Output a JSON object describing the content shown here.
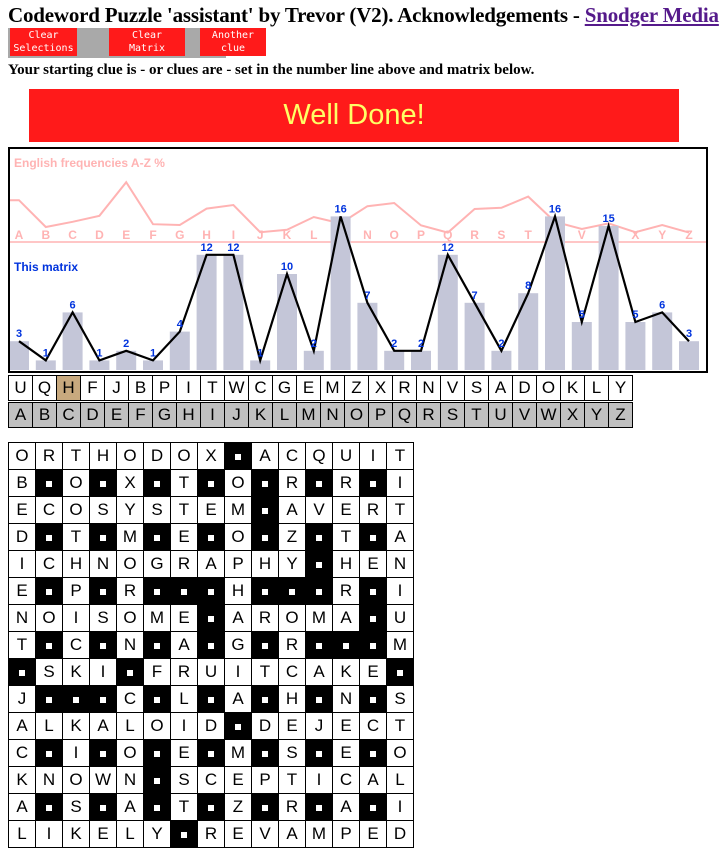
{
  "header": {
    "title": "Codeword Puzzle 'assistant' by Trevor (V2). Acknowledgements - ",
    "link": "Snodger Media"
  },
  "buttons": [
    {
      "line1": "Clear",
      "line2": "Selections"
    },
    {
      "line1": "Clear",
      "line2": "Matrix"
    },
    {
      "line1": "Another",
      "line2": "clue"
    }
  ],
  "instruction": "Your starting clue is - or clues are - set in the number line above and matrix below.",
  "banner": "Well Done!",
  "colors": {
    "accent_red": "#ff1a1a",
    "banner_text": "#ffff66",
    "english_line": "#ffb3b3",
    "matrix_label": "#0033dd",
    "bar_fill": "#c4c6d8",
    "highlight": "#c8a97e"
  },
  "chart_data": [
    {
      "type": "line",
      "title": "English frequencies A-Z %",
      "categories": [
        "A",
        "B",
        "C",
        "D",
        "E",
        "F",
        "G",
        "H",
        "I",
        "J",
        "K",
        "L",
        "M",
        "N",
        "O",
        "P",
        "Q",
        "R",
        "S",
        "T",
        "U",
        "V",
        "W",
        "X",
        "Y",
        "Z"
      ],
      "values": [
        8.2,
        1.5,
        2.8,
        4.3,
        12.7,
        2.2,
        2.0,
        6.1,
        7.0,
        0.2,
        0.8,
        4.0,
        2.4,
        6.7,
        7.5,
        1.9,
        0.1,
        6.0,
        6.3,
        9.1,
        2.8,
        1.0,
        2.4,
        0.2,
        2.0,
        0.1
      ]
    },
    {
      "type": "line",
      "title": "This matrix",
      "categories": [
        "A",
        "B",
        "C",
        "D",
        "E",
        "F",
        "G",
        "H",
        "I",
        "J",
        "K",
        "L",
        "M",
        "N",
        "O",
        "P",
        "Q",
        "R",
        "S",
        "T",
        "U",
        "V",
        "W",
        "X",
        "Y",
        "Z"
      ],
      "values": [
        3,
        1,
        6,
        1,
        2,
        1,
        4,
        12,
        12,
        1,
        10,
        2,
        16,
        7,
        2,
        2,
        12,
        7,
        2,
        8,
        16,
        5,
        15,
        5,
        6,
        3
      ]
    }
  ],
  "cipher_row": [
    "U",
    "Q",
    "H",
    "F",
    "J",
    "B",
    "P",
    "I",
    "T",
    "W",
    "C",
    "G",
    "E",
    "M",
    "Z",
    "X",
    "R",
    "N",
    "V",
    "S",
    "A",
    "D",
    "O",
    "K",
    "L",
    "Y"
  ],
  "alphabet_row": [
    "A",
    "B",
    "C",
    "D",
    "E",
    "F",
    "G",
    "H",
    "I",
    "J",
    "K",
    "L",
    "M",
    "N",
    "O",
    "P",
    "Q",
    "R",
    "S",
    "T",
    "U",
    "V",
    "W",
    "X",
    "Y",
    "Z"
  ],
  "grid": [
    "ORTHODOX#ACQUIT",
    "B#O#X#T#O#R#R#I",
    "ECOSYSTEM#AVERT",
    "D#T#M#E#O#Z#T#A",
    "ICHNOGRAPHY#HEN",
    "E#P#R###H###R#I",
    "NOISOME#AROMA#U",
    "T#C#N#A#G#R###M",
    "#SKI#FRUITCAKE#",
    "J###C#L#A#H#N#S",
    "ALKALOID#DEJECT",
    "C#I#O#E#M#S#E#O",
    "KNOWN#SCEPTICAL",
    "A#S#A#T#Z#R#A#I",
    "LIKELY#REVAMPED"
  ]
}
